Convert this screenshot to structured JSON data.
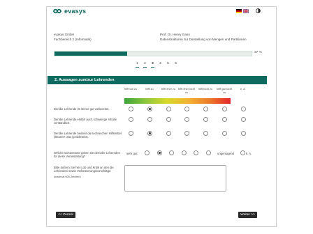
{
  "header": {
    "logo_text": "evasys",
    "lang_flags": [
      "de-flag-icon",
      "uk-flag-icon"
    ],
    "contrast_icon": "contrast-icon"
  },
  "info": {
    "org": "evasys GmbH",
    "dept": "Fachbereich 2 (Informatik)",
    "lecturer": "Prof. Dr. Henry Gann",
    "course": "Datenstrukturen zur Darstellung von Mengen und Partitionen"
  },
  "progress": {
    "fraction": 0.37,
    "label": "37 %"
  },
  "pages": {
    "items": [
      "1",
      "2",
      "3",
      "4",
      "5",
      "6"
    ],
    "current_index": 2
  },
  "section": {
    "title": "2. Aussagen zum/zur Lehrenden"
  },
  "scale": {
    "headers": [
      "trifft voll zu",
      "trifft zu",
      "trifft eher zu",
      "trifft eher nicht zu",
      "trifft nicht zu",
      "trifft gar nicht zu",
      "k. A."
    ]
  },
  "questions": [
    {
      "text": "Der/die Lehrende ist immer gut vorbereitet.",
      "selected": 1
    },
    {
      "text": "Der/die Lehrende erklärt auch schwierige Inhalte verständlich.",
      "selected": -1
    },
    {
      "text": "Der/die Lehrende bedient die technischen Hilfsmittel (Beamer usw.) problemlos.",
      "selected": 1
    }
  ],
  "overall": {
    "text": "Welche Gesamtnote geben sie dem/der Lehrenden für diese Veranstaltung?",
    "left_label": "sehr gut",
    "right_label": "ungenügend",
    "na_label": "k. A.",
    "count": 6,
    "selected": 1
  },
  "comment": {
    "text": "Bitte äußern Sie hier Lob und Kritik an den die Lehrenden sowie Verbesserungsvorschläge:",
    "hint": "(maximal 600 Zeichen)",
    "value": ""
  },
  "nav": {
    "back_label": "<< Zurück",
    "next_label": "Weiter >>"
  },
  "colors": {
    "accent": "#0e6a5e"
  }
}
